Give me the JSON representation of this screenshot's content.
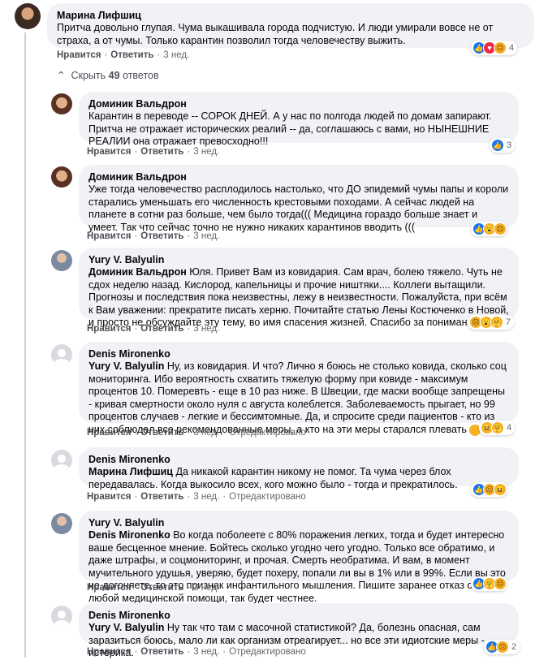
{
  "top": {
    "author": "Марина Лифшиц",
    "text": "Притча довольно глупая. Чума выкашивала города подчистую. И люди умирали вовсе не от страха, а от чумы. Только карантин позволил тогда человечеству выжить.",
    "like": "Нравится",
    "reply": "Ответить",
    "time": "3 нед.",
    "react_count": "4"
  },
  "toggle": {
    "icon": "chevron-up",
    "prefix": "Скрыть",
    "count": "49",
    "suffix": "ответов"
  },
  "replies": [
    {
      "author": "Доминик Вальдрон",
      "mention": "",
      "text": "Карантин в переводе -- СОРОК ДНЕЙ. А у нас по полгода людей по домам запирают. Притча не отражает исторических реалий -- да, соглашаюсь с вами, но НЫНЕШНИЕ РЕАЛИИ она отражает превосходно!!!",
      "like": "Нравится",
      "reply": "Ответить",
      "time": "3 нед.",
      "edited": "",
      "react_count": "3"
    },
    {
      "author": "Доминик Вальдрон",
      "mention": "",
      "text": "Уже тогда человечество расплодилось настолько, что ДО эпидемий чумы папы и короли старались уменьшать его численность крестовыми походами. А сейчас людей на планете в сотни раз больше, чем было тогда((( Медицина гораздо больше знает и умеет. Так что сейчас точно не нужно никаких карантинов вводить (((",
      "like": "Нравится",
      "reply": "Ответить",
      "time": "3 нед.",
      "edited": "",
      "react_count": ""
    },
    {
      "author": "Yury V. Balyulin",
      "mention": "Доминик Вальдрон",
      "text": " Юля. Привет Вам из ковидария. Сам врач, болею тяжело. Чуть не сдох неделю назад. Кислород, капельницы и прочие ништяки.... Коллеги вытащили. Прогнозы и последствия пока неизвестны, лежу в неизвестности. Пожалуйста, при всём к Вам уважении: прекратите писать херню. Почитайте статью Лены Костюченко в Новой, и просто не обсуждайте эту тему, во имя спасения жизней. Спасибо за понимание.",
      "like": "Нравится",
      "reply": "Ответить",
      "time": "3 нед.",
      "edited": "",
      "react_count": "7"
    },
    {
      "author": "Denis Mironenko",
      "mention": "Yury V. Balyulin",
      "text": " Ну, из ковидария. И что? Лично я боюсь не столько ковида, сколько соц мониторинга. Ибо вероятность схватить тяжелую форму при ковиде - максимум процентов 10. Померевть - еще в 10 раз ниже. В Швеции, где маски вообще запрещены - кривая смертности около нуля с августа колеблется. Заболеваемость прыгает, но 99 процентов случаев - легкие и бессимтомные. Да, и спросите среди пациентов - кто из них соблюдал все рекомендованные меры, а кто на эти меры старался плевать",
      "like": "Нравится",
      "reply": "Ответить",
      "time": "3 нед.",
      "edited": "Отредактировано",
      "react_count": "4"
    },
    {
      "author": "Denis Mironenko",
      "mention": "Марина Лифшиц",
      "text": " Да никакой карантин никому не помог. Та чума через блох передавалась. Когда выкосило всех, кого можно было - тогда и прекратилось.",
      "like": "Нравится",
      "reply": "Ответить",
      "time": "3 нед.",
      "edited": "Отредактировано",
      "react_count": ""
    },
    {
      "author": "Yury V. Balyulin",
      "mention": "Denis Mironenko",
      "text": " Во когда поболеете с 80% поражения легких, тогда и будет интересно ваше бесценное мнение. Бойтесь сколько угодно чего угодно. Только все обратимо, и даже штрафы, и соцмониторинг, и прочая. Смерть необратима. И вам, в момент мучительного удушья, уверяю, будет похеру, попали ли вы в 1% или в 99%. Если вы это не догоняете, то это признак инфантильного мышления. Пишите заранее отказ от любой медицинской помощи, так будет честнее.",
      "like": "Нравится",
      "reply": "Ответить",
      "time": "3 нед.",
      "edited": "",
      "react_count": ""
    },
    {
      "author": "Denis Mironenko",
      "mention": "Yury V. Balyulin",
      "text": " Ну так что там с масочной статистикой? Да, болезнь опасная, сам заразиться боюсь, мало ли как организм отреагирует... но все эти идиотские меры - истерика.",
      "like": "Нравится",
      "reply": "Ответить",
      "time": "3 нед.",
      "edited": "Отредактировано",
      "react_count": "2"
    }
  ]
}
